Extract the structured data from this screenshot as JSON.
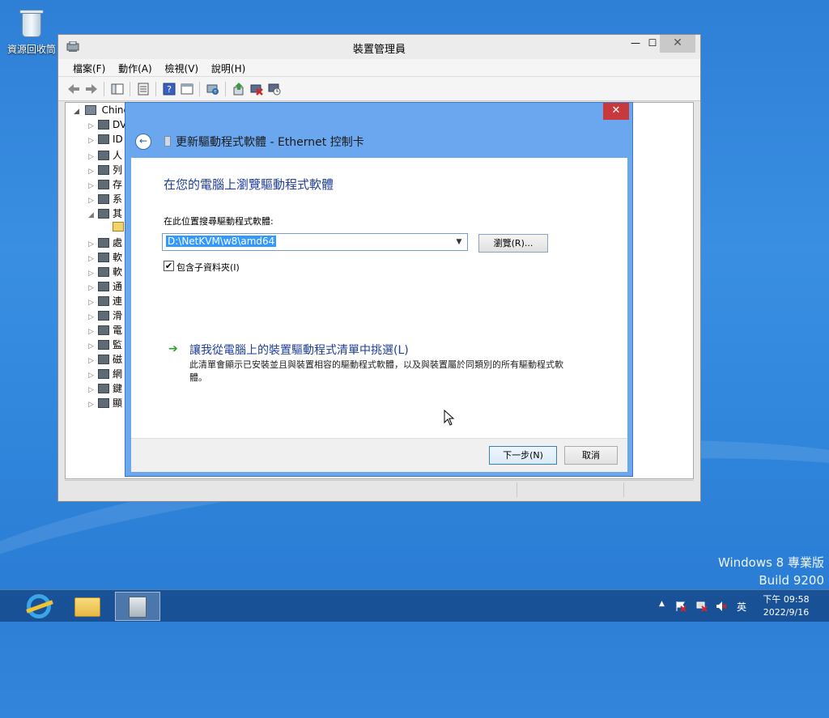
{
  "desktop": {
    "recycle_bin_label": "資源回收筒",
    "watermark_line1": "Windows 8 專業版",
    "watermark_line2": "Build 9200"
  },
  "device_manager": {
    "title": "裝置管理員",
    "menu": [
      "檔案(F)",
      "動作(A)",
      "檢視(V)",
      "說明(H)"
    ],
    "tree_root": "Chine",
    "tree_items": [
      {
        "label": "DV",
        "expanded": false
      },
      {
        "label": "ID",
        "expanded": false
      },
      {
        "label": "人",
        "expanded": false
      },
      {
        "label": "列",
        "expanded": false
      },
      {
        "label": "存",
        "expanded": false
      },
      {
        "label": "系",
        "expanded": false
      },
      {
        "label": "其",
        "expanded": true
      },
      {
        "label": "",
        "expanded": false
      },
      {
        "label": "處",
        "expanded": false
      },
      {
        "label": "軟",
        "expanded": false
      },
      {
        "label": "軟",
        "expanded": false
      },
      {
        "label": "通",
        "expanded": false
      },
      {
        "label": "連",
        "expanded": false
      },
      {
        "label": "滑",
        "expanded": false
      },
      {
        "label": "電",
        "expanded": false
      },
      {
        "label": "監",
        "expanded": false
      },
      {
        "label": "磁",
        "expanded": false
      },
      {
        "label": "網",
        "expanded": false
      },
      {
        "label": "鍵",
        "expanded": false
      },
      {
        "label": "顯",
        "expanded": false
      }
    ]
  },
  "wizard": {
    "title": "更新驅動程式軟體 - Ethernet 控制卡",
    "close_label": "✕",
    "heading": "在您的電腦上瀏覽驅動程式軟體",
    "search_label": "在此位置搜尋驅動程式軟體:",
    "path_value": "D:\\NetKVM\\w8\\amd64",
    "browse_label": "瀏覽(R)...",
    "include_subfolders_label": "包含子資料夾(I)",
    "include_subfolders_checked": true,
    "pick_link_title": "讓我從電腦上的裝置驅動程式清單中挑選(L)",
    "pick_link_desc": "此清單會顯示已安裝並且與裝置相容的驅動程式軟體，以及與裝置屬於同類別的所有驅動程式軟體。",
    "next_label": "下一步(N)",
    "cancel_label": "取消"
  },
  "taskbar": {
    "ime_label": "英",
    "time": "下午 09:58",
    "date": "2022/9/16",
    "apps": [
      "internet-explorer",
      "file-explorer",
      "device-manager"
    ]
  }
}
